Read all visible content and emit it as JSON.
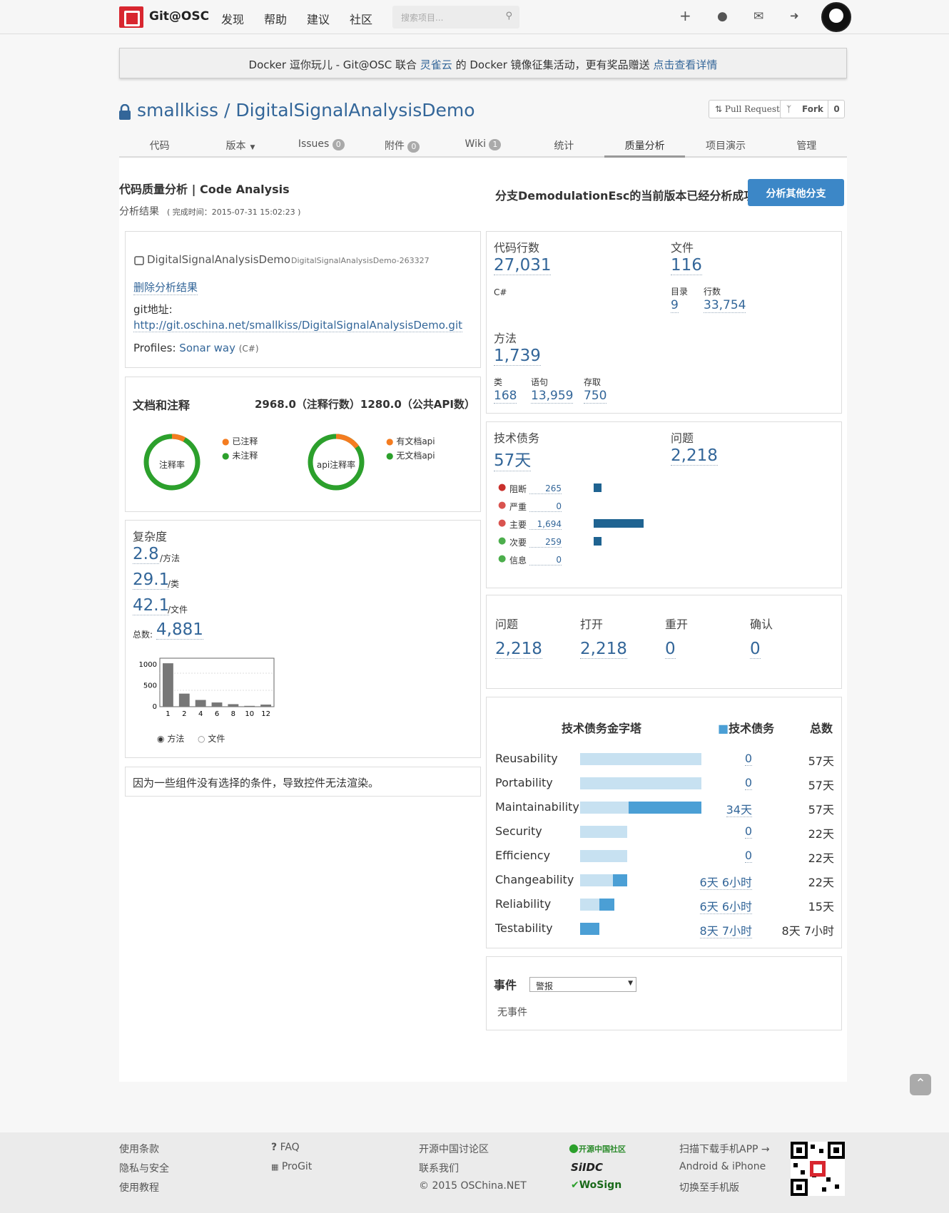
{
  "header": {
    "brand": "Git@OSC",
    "nav": [
      "发现",
      "帮助",
      "建议",
      "社区"
    ],
    "search_placeholder": "搜索项目..."
  },
  "notice": {
    "text1": "Docker 逗你玩儿 - Git@OSC 联合 ",
    "link1": "灵雀云",
    "text2": " 的 Docker 镜像征集活动，更有奖品赠送 ",
    "link2": "点击查看详情"
  },
  "repo": {
    "title": "smallkiss / DigitalSignalAnalysisDemo",
    "pull_request": "Pull Request",
    "fork": "Fork",
    "fork_count": "0"
  },
  "tabs": [
    {
      "label": "代码",
      "badge": ""
    },
    {
      "label": "版本",
      "badge": ""
    },
    {
      "label": "Issues",
      "badge": "0"
    },
    {
      "label": "附件",
      "badge": "0"
    },
    {
      "label": "Wiki",
      "badge": "1"
    },
    {
      "label": "统计",
      "badge": ""
    },
    {
      "label": "质量分析",
      "badge": ""
    },
    {
      "label": "项目演示",
      "badge": ""
    },
    {
      "label": "管理",
      "badge": ""
    }
  ],
  "analysis": {
    "title": "代码质量分析 | Code Analysis",
    "result_label": "分析结果",
    "finish_time": "( 完成时间：2015-07-31 15:02:23 )",
    "status": "分支DemodulationEsc的当前版本已经分析成功",
    "analyze_button": "分析其他分支"
  },
  "project": {
    "name": "DigitalSignalAnalysisDemo",
    "key": "DigitalSignalAnalysisDemo-263327",
    "delete_link": "删除分析结果",
    "git_label": "git地址:",
    "git_url": "http://git.oschina.net/smallkiss/DigitalSignalAnalysisDemo.git",
    "profiles_label": "Profiles:",
    "profile_name": "Sonar way",
    "profile_lang": "(C#)"
  },
  "docs": {
    "title": "文档和注释",
    "summary": "2968.0（注释行数）1280.0（公共API数）",
    "donut1": {
      "label": "注释率",
      "fraction": 0.08,
      "legend": [
        "已注释",
        "未注释"
      ]
    },
    "donut2": {
      "label": "api注释率",
      "fraction": 0.15,
      "legend": [
        "有文档api",
        "无文档api"
      ]
    },
    "colors": {
      "done": "#f47c20",
      "rest": "#2ca02c"
    }
  },
  "complexity": {
    "title": "复杂度",
    "per_method": "2.8",
    "per_method_unit": "/方法",
    "per_class": "29.1",
    "per_class_unit": "/类",
    "per_file": "42.1",
    "per_file_unit": "/文件",
    "total_label": "总数:",
    "total": "4,881",
    "radio": [
      "方法",
      "文件"
    ]
  },
  "chart_data": {
    "type": "bar",
    "categories": [
      "1",
      "2",
      "4",
      "6",
      "8",
      "10",
      "12"
    ],
    "values": [
      1030,
      310,
      160,
      100,
      60,
      20,
      50
    ],
    "ylim": [
      0,
      1150
    ],
    "yticks": [
      "1000",
      "500",
      "0"
    ]
  },
  "render_msg": "因为一些组件没有选择的条件，导致控件无法渲染。",
  "size": {
    "lines_label": "代码行数",
    "lines": "27,031",
    "lang": "C#",
    "files_label": "文件",
    "files": "116",
    "dirs_label": "目录",
    "dirs": "9",
    "rows_label": "行数",
    "rows": "33,754",
    "methods_label": "方法",
    "methods": "1,739",
    "classes_label": "类",
    "classes": "168",
    "statements_label": "语句",
    "statements": "13,959",
    "accessors_label": "存取",
    "accessors": "750"
  },
  "debt": {
    "label": "技术债务",
    "value": "57天",
    "issues_label": "问题",
    "issues": "2,218",
    "severities": [
      {
        "name": "阻断",
        "count": "265",
        "n": 265,
        "color": "#c9302c"
      },
      {
        "name": "严重",
        "count": "0",
        "n": 0,
        "color": "#d9534f"
      },
      {
        "name": "主要",
        "count": "1,694",
        "n": 1694,
        "color": "#d9534f"
      },
      {
        "name": "次要",
        "count": "259",
        "n": 259,
        "color": "#4cae4c"
      },
      {
        "name": "信息",
        "count": "0",
        "n": 0,
        "color": "#4cae4c"
      }
    ]
  },
  "issue_counts": [
    {
      "label": "问题",
      "value": "2,218"
    },
    {
      "label": "打开",
      "value": "2,218"
    },
    {
      "label": "重开",
      "value": "0"
    },
    {
      "label": "确认",
      "value": "0"
    }
  ],
  "pyramid": {
    "title": "技术债务金字塔",
    "debt_col": "技术债务",
    "total_col": "总数",
    "rows": [
      {
        "name": "Reusability",
        "debt": "0",
        "total": "57天",
        "tfrac": 1.0,
        "dfrac": 0
      },
      {
        "name": "Portability",
        "debt": "0",
        "total": "57天",
        "tfrac": 1.0,
        "dfrac": 0
      },
      {
        "name": "Maintainability",
        "debt": "34天",
        "total": "57天",
        "tfrac": 1.0,
        "dfrac": 0.6
      },
      {
        "name": "Security",
        "debt": "0",
        "total": "22天",
        "tfrac": 0.39,
        "dfrac": 0
      },
      {
        "name": "Efficiency",
        "debt": "0",
        "total": "22天",
        "tfrac": 0.39,
        "dfrac": 0
      },
      {
        "name": "Changeability",
        "debt": "6天 6小时",
        "total": "22天",
        "tfrac": 0.39,
        "dfrac": 0.12
      },
      {
        "name": "Reliability",
        "debt": "6天 6小时",
        "total": "15天",
        "tfrac": 0.28,
        "dfrac": 0.12
      },
      {
        "name": "Testability",
        "debt": "8天 7小时",
        "total": "8天 7小时",
        "tfrac": 0.16,
        "dfrac": 0.16
      }
    ]
  },
  "events": {
    "title": "事件",
    "select": "警报",
    "empty": "无事件"
  },
  "footer": {
    "col1": [
      "使用条款",
      "隐私与安全",
      "使用教程"
    ],
    "col2": [
      "FAQ",
      "ProGit"
    ],
    "col3": [
      "开源中国讨论区",
      "联系我们",
      "© 2015 OSChina.NET"
    ],
    "badges": [
      "开源中国社区",
      "SiIDC",
      "WoSign"
    ],
    "col5": [
      "扫描下载手机APP →",
      "Android & iPhone",
      "切换至手机版"
    ]
  }
}
